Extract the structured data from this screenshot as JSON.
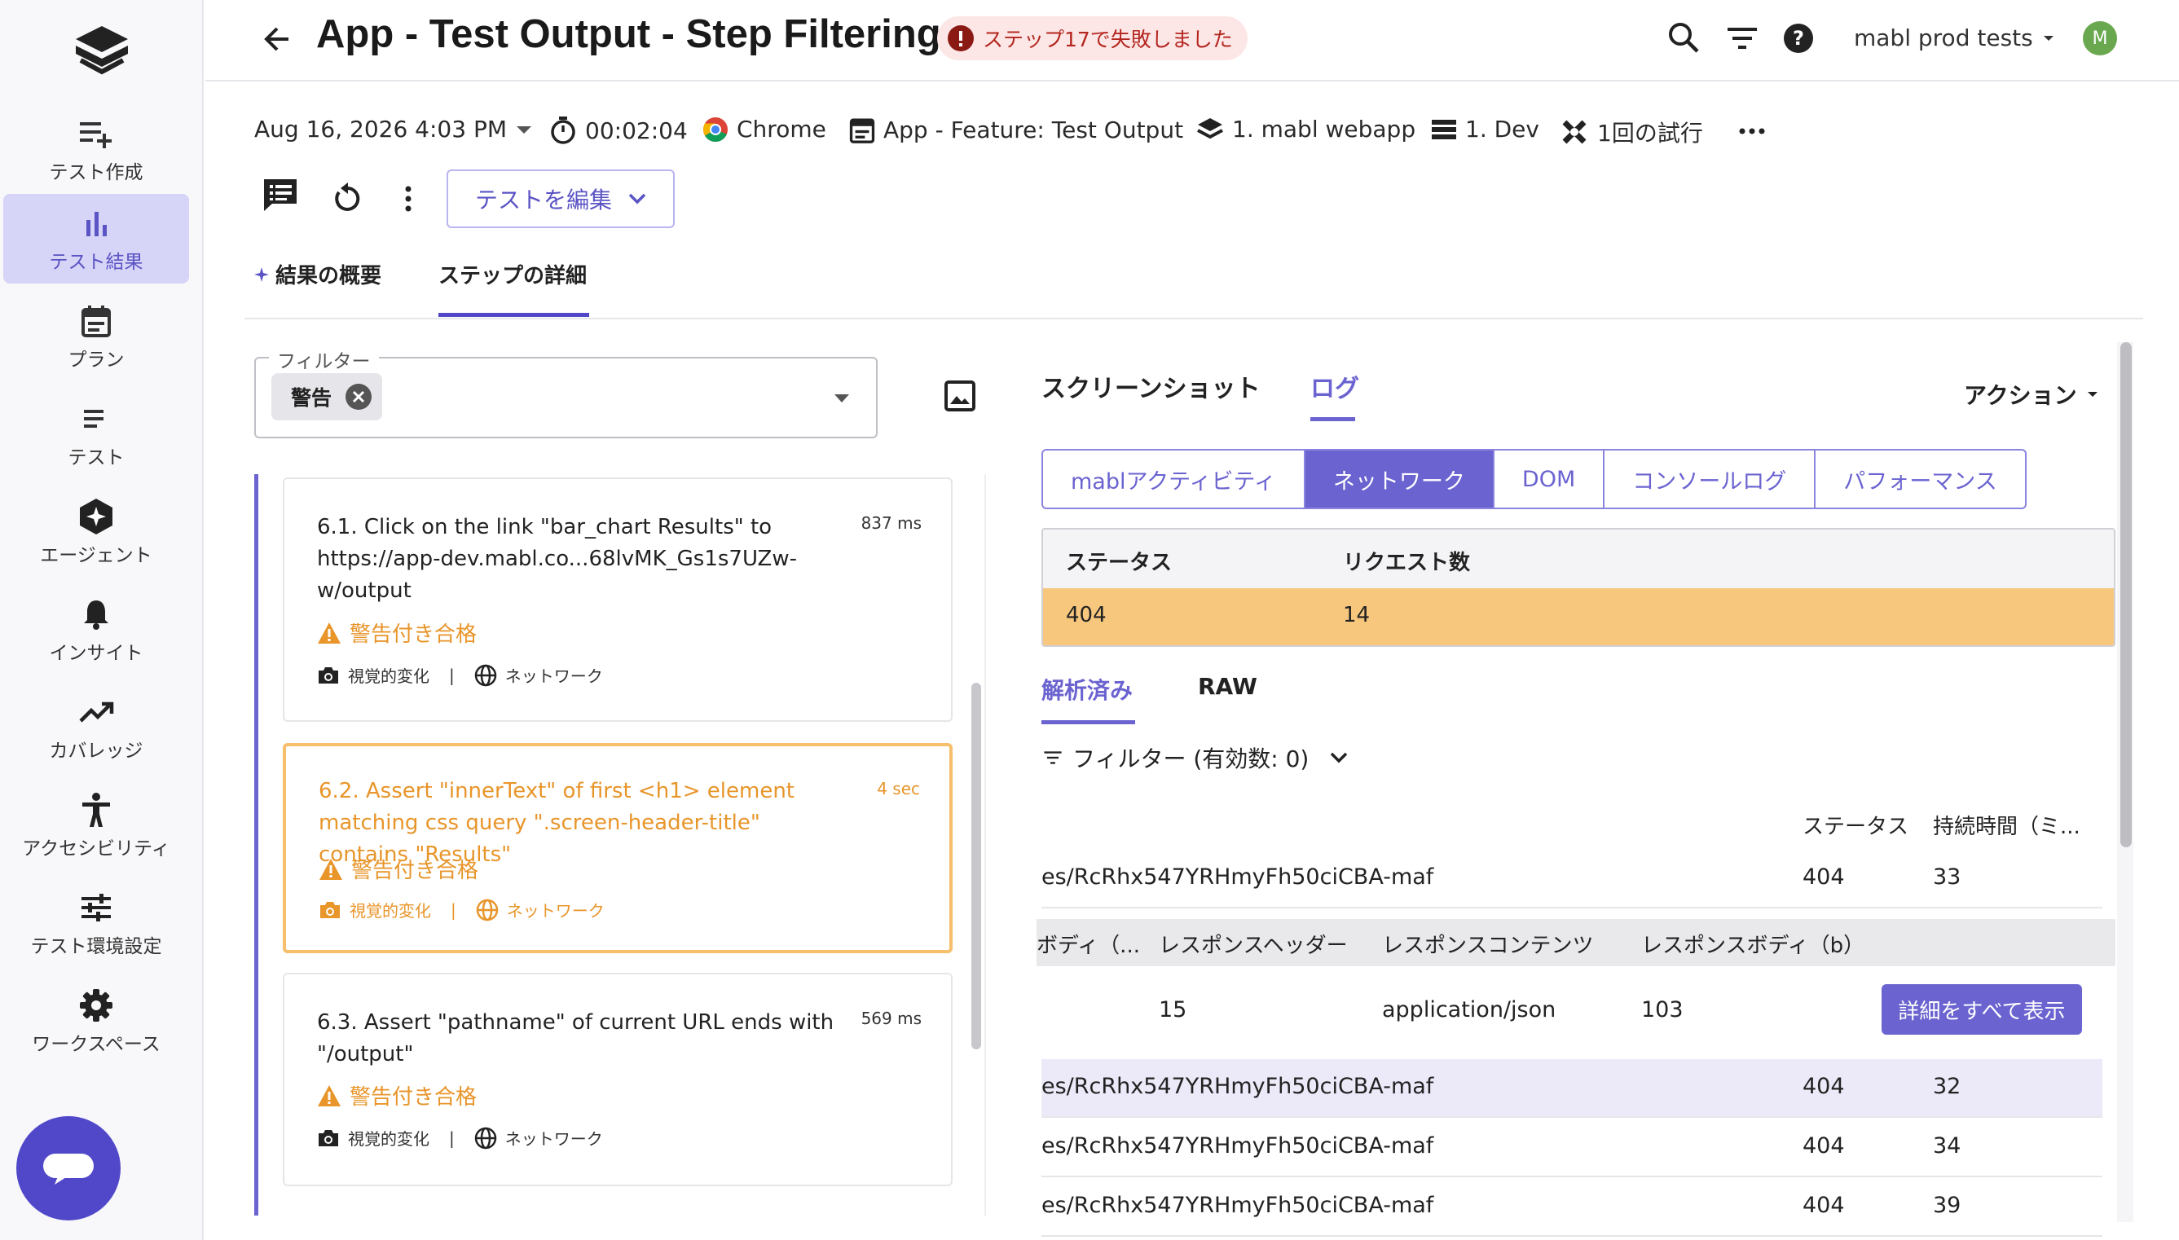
{
  "sidebar": {
    "items": [
      {
        "label": "テスト作成",
        "icon": "playlist-add-icon"
      },
      {
        "label": "テスト結果",
        "icon": "bar-chart-icon",
        "active": true
      },
      {
        "label": "プラン",
        "icon": "calendar-icon"
      },
      {
        "label": "テスト",
        "icon": "list-icon"
      },
      {
        "label": "エージェント",
        "icon": "agent-icon"
      },
      {
        "label": "インサイト",
        "icon": "bell-icon"
      },
      {
        "label": "カバレッジ",
        "icon": "trending-up-icon"
      },
      {
        "label": "アクセシビリティ",
        "icon": "accessibility-icon"
      },
      {
        "label": "テスト環境設定",
        "icon": "sliders-icon"
      },
      {
        "label": "ワークスペース",
        "icon": "gear-icon"
      }
    ]
  },
  "header": {
    "title": "App - Test Output - Step Filtering",
    "fail_badge": "ステップ17で失敗しました",
    "workspace": "mabl prod tests",
    "avatar_initial": "M"
  },
  "meta": {
    "datetime": "Aug 16, 2026 4:03 PM",
    "duration": "00:02:04",
    "browser": "Chrome",
    "plan": "App - Feature: Test Output",
    "application": "1. mabl webapp",
    "environment": "1. Dev",
    "attempts": "1回の試行"
  },
  "toolbar": {
    "edit_label": "テストを編集"
  },
  "tabs": {
    "summary": "結果の概要",
    "details": "ステップの詳細"
  },
  "filter": {
    "legend": "フィルター",
    "chip": "警告"
  },
  "steps": [
    {
      "text": "6.1. Click on the link \"bar_chart Results\" to https://app-dev.mabl.co...68lvMK_Gs1s7UZw-w/output",
      "duration": "837 ms",
      "status": "警告付き合格",
      "visual": "視覚的変化",
      "network": "ネットワーク"
    },
    {
      "text": "6.2. Assert \"innerText\" of first <h1> element matching css query \".screen-header-title\" contains \"Results\"",
      "duration": "4 sec",
      "status": "警告付き合格",
      "visual": "視覚的変化",
      "network": "ネットワーク"
    },
    {
      "text": "6.3. Assert \"pathname\" of current URL ends with \"/output\"",
      "duration": "569 ms",
      "status": "警告付き合格",
      "visual": "視覚的変化",
      "network": "ネットワーク"
    }
  ],
  "right": {
    "tabs": {
      "screenshot": "スクリーンショット",
      "logs": "ログ"
    },
    "actions": "アクション",
    "segments": [
      "mablアクティビティ",
      "ネットワーク",
      "DOM",
      "コンソールログ",
      "パフォーマンス"
    ],
    "summary": {
      "status_header": "ステータス",
      "count_header": "リクエスト数",
      "status": "404",
      "count": "14"
    },
    "subtabs": {
      "parsed": "解析済み",
      "raw": "RAW"
    },
    "filter_label": "フィルター (有効数: 0)",
    "columns": {
      "status": "ステータス",
      "duration": "持続時間（ミ..."
    },
    "rows": [
      {
        "url": "es/RcRhx547YRHmyFh50ciCBA-maf",
        "status": "404",
        "duration": "33"
      },
      {
        "url": "es/RcRhx547YRHmyFh50ciCBA-maf",
        "status": "404",
        "duration": "32"
      },
      {
        "url": "es/RcRhx547YRHmyFh50ciCBA-maf",
        "status": "404",
        "duration": "34"
      },
      {
        "url": "es/RcRhx547YRHmyFh50ciCBA-maf",
        "status": "404",
        "duration": "39"
      }
    ],
    "detail": {
      "headers": [
        "ボディ（...",
        "レスポンスヘッダー",
        "レスポンスコンテンツ",
        "レスポンスボディ（b）"
      ],
      "values": [
        "15",
        "application/json",
        "103"
      ],
      "show_all": "詳細をすべて表示"
    }
  },
  "colors": {
    "accent": "#6a63d0",
    "warning": "#e8952a",
    "error": "#b3261e",
    "highlight": "#f7c77e"
  }
}
